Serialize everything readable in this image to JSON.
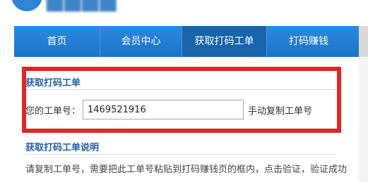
{
  "nav": {
    "items": [
      {
        "label": "首页"
      },
      {
        "label": "会员中心"
      },
      {
        "label": "获取打码工单"
      },
      {
        "label": "打码赚钱"
      }
    ]
  },
  "get_order": {
    "title": "获取打码工单",
    "label": "您的工单号：",
    "order_number": "1469521916",
    "copy_label": "手动复制工单号"
  },
  "instructions": {
    "title": "获取打码工单说明",
    "text": "请复制工单号，需要把此工单号粘贴到打码赚钱页的框内，点击验证，验证成功"
  },
  "colors": {
    "nav_blue": "#1a73c9",
    "highlight_red": "#e02525",
    "title_blue": "#1d5fa5"
  }
}
